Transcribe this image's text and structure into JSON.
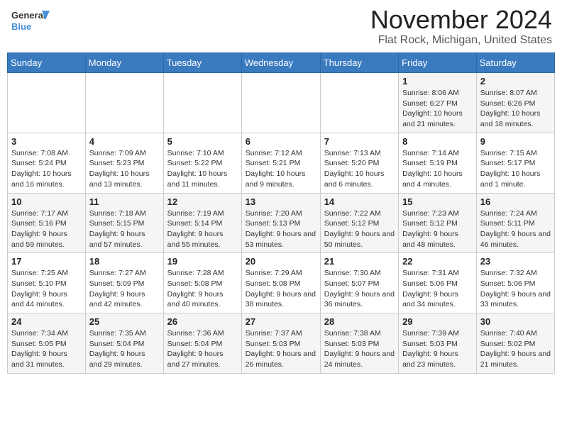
{
  "logo": {
    "line1": "General",
    "line2": "Blue"
  },
  "header": {
    "month": "November 2024",
    "location": "Flat Rock, Michigan, United States"
  },
  "days_of_week": [
    "Sunday",
    "Monday",
    "Tuesday",
    "Wednesday",
    "Thursday",
    "Friday",
    "Saturday"
  ],
  "weeks": [
    [
      {
        "day": "",
        "info": ""
      },
      {
        "day": "",
        "info": ""
      },
      {
        "day": "",
        "info": ""
      },
      {
        "day": "",
        "info": ""
      },
      {
        "day": "",
        "info": ""
      },
      {
        "day": "1",
        "info": "Sunrise: 8:06 AM\nSunset: 6:27 PM\nDaylight: 10 hours and 21 minutes."
      },
      {
        "day": "2",
        "info": "Sunrise: 8:07 AM\nSunset: 6:26 PM\nDaylight: 10 hours and 18 minutes."
      }
    ],
    [
      {
        "day": "3",
        "info": "Sunrise: 7:08 AM\nSunset: 5:24 PM\nDaylight: 10 hours and 16 minutes."
      },
      {
        "day": "4",
        "info": "Sunrise: 7:09 AM\nSunset: 5:23 PM\nDaylight: 10 hours and 13 minutes."
      },
      {
        "day": "5",
        "info": "Sunrise: 7:10 AM\nSunset: 5:22 PM\nDaylight: 10 hours and 11 minutes."
      },
      {
        "day": "6",
        "info": "Sunrise: 7:12 AM\nSunset: 5:21 PM\nDaylight: 10 hours and 9 minutes."
      },
      {
        "day": "7",
        "info": "Sunrise: 7:13 AM\nSunset: 5:20 PM\nDaylight: 10 hours and 6 minutes."
      },
      {
        "day": "8",
        "info": "Sunrise: 7:14 AM\nSunset: 5:19 PM\nDaylight: 10 hours and 4 minutes."
      },
      {
        "day": "9",
        "info": "Sunrise: 7:15 AM\nSunset: 5:17 PM\nDaylight: 10 hours and 1 minute."
      }
    ],
    [
      {
        "day": "10",
        "info": "Sunrise: 7:17 AM\nSunset: 5:16 PM\nDaylight: 9 hours and 59 minutes."
      },
      {
        "day": "11",
        "info": "Sunrise: 7:18 AM\nSunset: 5:15 PM\nDaylight: 9 hours and 57 minutes."
      },
      {
        "day": "12",
        "info": "Sunrise: 7:19 AM\nSunset: 5:14 PM\nDaylight: 9 hours and 55 minutes."
      },
      {
        "day": "13",
        "info": "Sunrise: 7:20 AM\nSunset: 5:13 PM\nDaylight: 9 hours and 53 minutes."
      },
      {
        "day": "14",
        "info": "Sunrise: 7:22 AM\nSunset: 5:12 PM\nDaylight: 9 hours and 50 minutes."
      },
      {
        "day": "15",
        "info": "Sunrise: 7:23 AM\nSunset: 5:12 PM\nDaylight: 9 hours and 48 minutes."
      },
      {
        "day": "16",
        "info": "Sunrise: 7:24 AM\nSunset: 5:11 PM\nDaylight: 9 hours and 46 minutes."
      }
    ],
    [
      {
        "day": "17",
        "info": "Sunrise: 7:25 AM\nSunset: 5:10 PM\nDaylight: 9 hours and 44 minutes."
      },
      {
        "day": "18",
        "info": "Sunrise: 7:27 AM\nSunset: 5:09 PM\nDaylight: 9 hours and 42 minutes."
      },
      {
        "day": "19",
        "info": "Sunrise: 7:28 AM\nSunset: 5:08 PM\nDaylight: 9 hours and 40 minutes."
      },
      {
        "day": "20",
        "info": "Sunrise: 7:29 AM\nSunset: 5:08 PM\nDaylight: 9 hours and 38 minutes."
      },
      {
        "day": "21",
        "info": "Sunrise: 7:30 AM\nSunset: 5:07 PM\nDaylight: 9 hours and 36 minutes."
      },
      {
        "day": "22",
        "info": "Sunrise: 7:31 AM\nSunset: 5:06 PM\nDaylight: 9 hours and 34 minutes."
      },
      {
        "day": "23",
        "info": "Sunrise: 7:32 AM\nSunset: 5:06 PM\nDaylight: 9 hours and 33 minutes."
      }
    ],
    [
      {
        "day": "24",
        "info": "Sunrise: 7:34 AM\nSunset: 5:05 PM\nDaylight: 9 hours and 31 minutes."
      },
      {
        "day": "25",
        "info": "Sunrise: 7:35 AM\nSunset: 5:04 PM\nDaylight: 9 hours and 29 minutes."
      },
      {
        "day": "26",
        "info": "Sunrise: 7:36 AM\nSunset: 5:04 PM\nDaylight: 9 hours and 27 minutes."
      },
      {
        "day": "27",
        "info": "Sunrise: 7:37 AM\nSunset: 5:03 PM\nDaylight: 9 hours and 26 minutes."
      },
      {
        "day": "28",
        "info": "Sunrise: 7:38 AM\nSunset: 5:03 PM\nDaylight: 9 hours and 24 minutes."
      },
      {
        "day": "29",
        "info": "Sunrise: 7:39 AM\nSunset: 5:03 PM\nDaylight: 9 hours and 23 minutes."
      },
      {
        "day": "30",
        "info": "Sunrise: 7:40 AM\nSunset: 5:02 PM\nDaylight: 9 hours and 21 minutes."
      }
    ]
  ]
}
